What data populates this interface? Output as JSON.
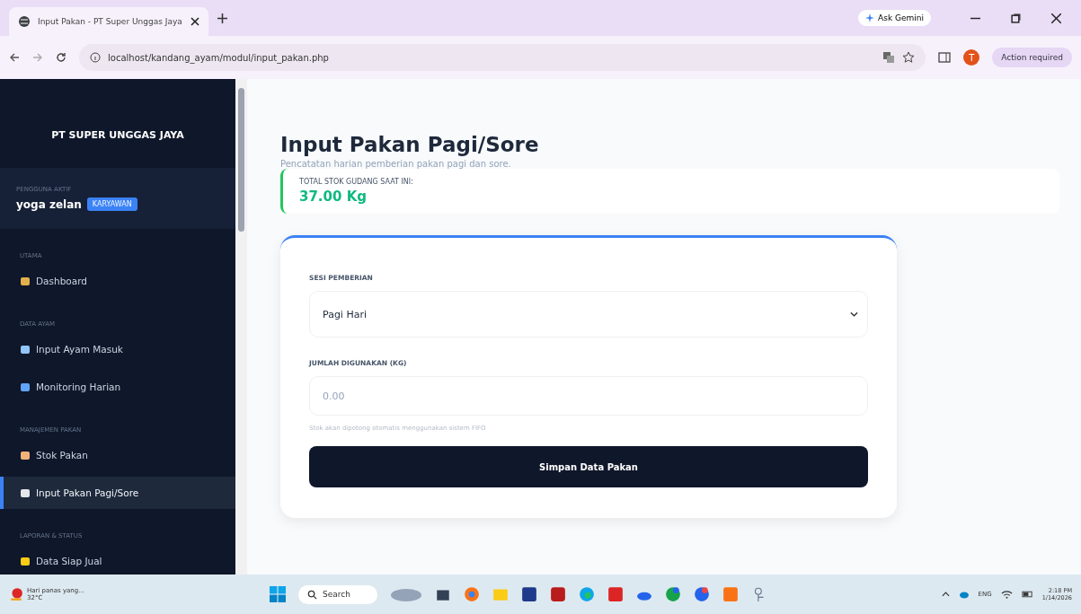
{
  "browser": {
    "tab_title": "Input Pakan - PT Super Unggas Jaya",
    "url": "localhost/kandang_ayam/modul/input_pakan.php",
    "gemini": "Ask Gemini",
    "profile_initial": "T",
    "action": "Action required"
  },
  "sidebar": {
    "brand": "PT SUPER UNGGAS JAYA",
    "user_caption": "PENGGUNA AKTIF",
    "user_name": "yoga zelan",
    "role": "KARYAWAN",
    "sections": [
      {
        "title": "UTAMA",
        "items": [
          {
            "label": "Dashboard",
            "kind": "house",
            "selected": false
          }
        ]
      },
      {
        "title": "DATA AYAM",
        "items": [
          {
            "label": "Input Ayam Masuk",
            "kind": "box",
            "selected": false
          },
          {
            "label": "Monitoring Harian",
            "kind": "search",
            "selected": false
          }
        ]
      },
      {
        "title": "MANAJEMEN PAKAN",
        "items": [
          {
            "label": "Stok Pakan",
            "kind": "grain",
            "selected": false
          },
          {
            "label": "Input Pakan Pagi/Sore",
            "kind": "utensils",
            "selected": true
          }
        ]
      },
      {
        "title": "LAPORAN & STATUS",
        "items": [
          {
            "label": "Data Siap Jual",
            "kind": "chick",
            "selected": false
          }
        ]
      }
    ]
  },
  "page": {
    "title": "Input Pakan Pagi/Sore",
    "subtitle": "Pencatatan harian pemberian pakan pagi dan sore.",
    "stock_label": "TOTAL STOK GUDANG SAAT INI:",
    "stock_value": "37.00 Kg",
    "form": {
      "session_label": "SESI PEMBERIAN",
      "session_value": "Pagi Hari",
      "amount_label": "JUMLAH DIGUNAKAN (KG)",
      "amount_placeholder": "0.00",
      "hint": "Stok akan dipotong otomatis menggunakan sistem FIFO",
      "submit": "Simpan Data Pakan"
    }
  },
  "taskbar": {
    "weather": "Hari panas yang...",
    "temp": "32°C",
    "search": "Search",
    "lang": "ENG",
    "time": "2:18 PM",
    "date": "1/14/2026"
  }
}
